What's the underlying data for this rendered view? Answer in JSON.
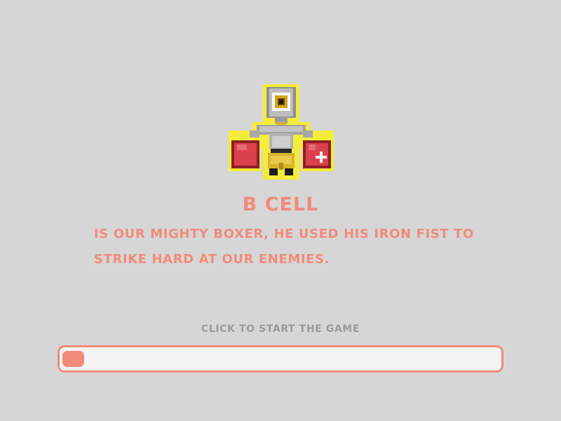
{
  "character": {
    "sprite": "b-cell-boxer-sprite",
    "name": "B CELL",
    "description": "IS OUR MIGHTY BOXER, HE USED HIS IRON FIST TO STRIKE HARD AT OUR ENEMIES."
  },
  "loader": {
    "start_label": "CLICK TO START THE GAME",
    "progress": 0.05
  },
  "colors": {
    "background": "#d6d6d6",
    "accent": "#f28b7a",
    "muted_text": "#9a9a9a",
    "track": "#f4f4f4"
  }
}
